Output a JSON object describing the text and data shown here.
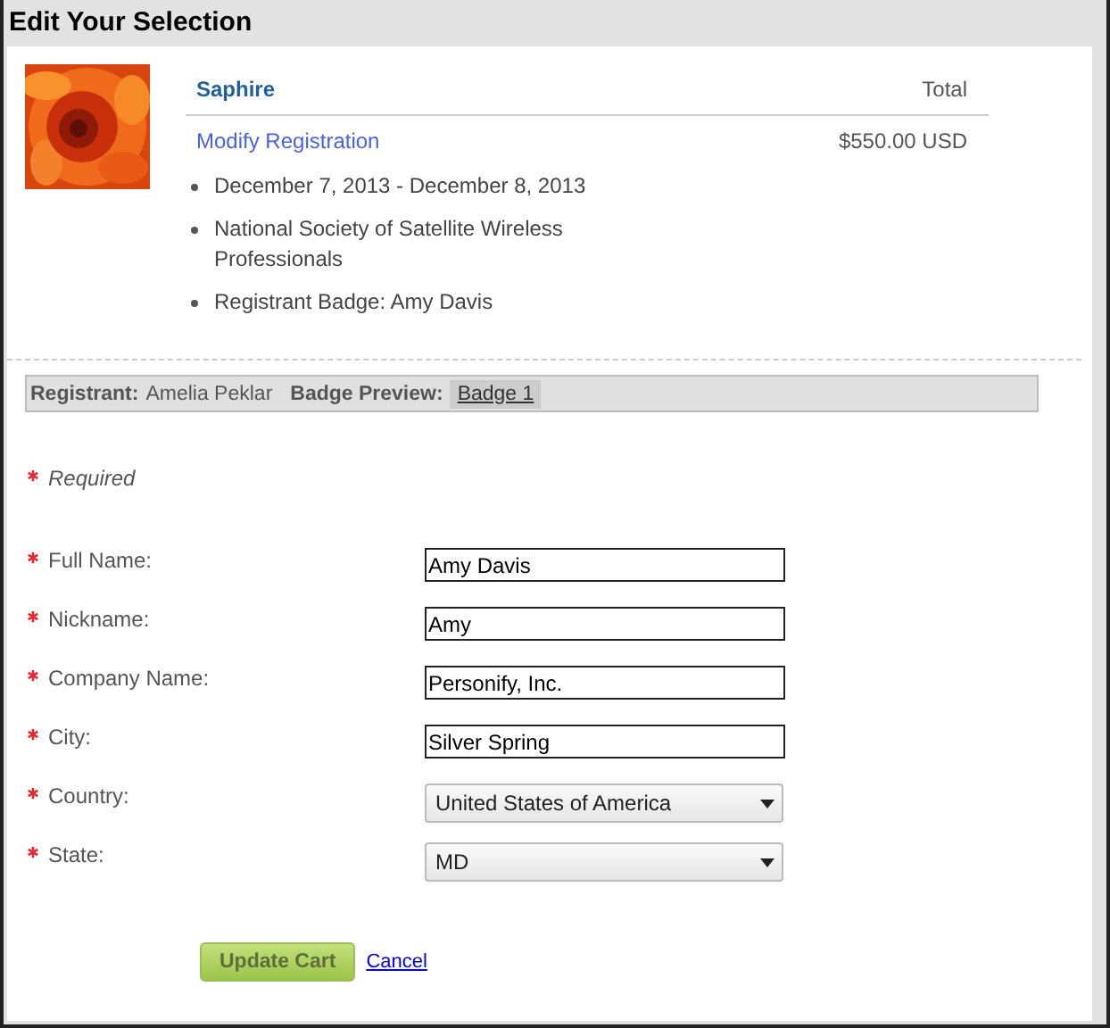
{
  "window": {
    "title": "Edit Your Selection"
  },
  "item": {
    "kind": "picture",
    "name": "Saphire",
    "total_label": "Total",
    "modify_link": "Modify Registration",
    "price": "$550.00 USD",
    "details": [
      "December 7, 2013 - December 8, 2013",
      "National Society of Satellite Wireless Professionals",
      "Registrant Badge: Amy Davis"
    ]
  },
  "registrant_bar": {
    "registrant_label": "Registrant:",
    "registrant": "Amelia Peklar",
    "badge_label": "Badge Preview:",
    "badge_tab": "Badge 1"
  },
  "required_note": "Required",
  "fields": [
    {
      "kind": "text",
      "label": "Full Name:",
      "value": "Amy Davis",
      "required": true
    },
    {
      "kind": "text",
      "label": "Nickname:",
      "value": "Amy",
      "required": true
    },
    {
      "kind": "text",
      "label": "Company Name:",
      "value": "Personify, Inc.",
      "required": true
    },
    {
      "kind": "text",
      "label": "City:",
      "value": "Silver Spring",
      "required": true
    },
    {
      "kind": "select",
      "label": "Country:",
      "value": "United States of America",
      "required": true
    },
    {
      "kind": "select",
      "label": "State:",
      "value": "MD",
      "required": true
    }
  ],
  "buttons": {
    "update": "Update Cart",
    "cancel": "Cancel"
  }
}
